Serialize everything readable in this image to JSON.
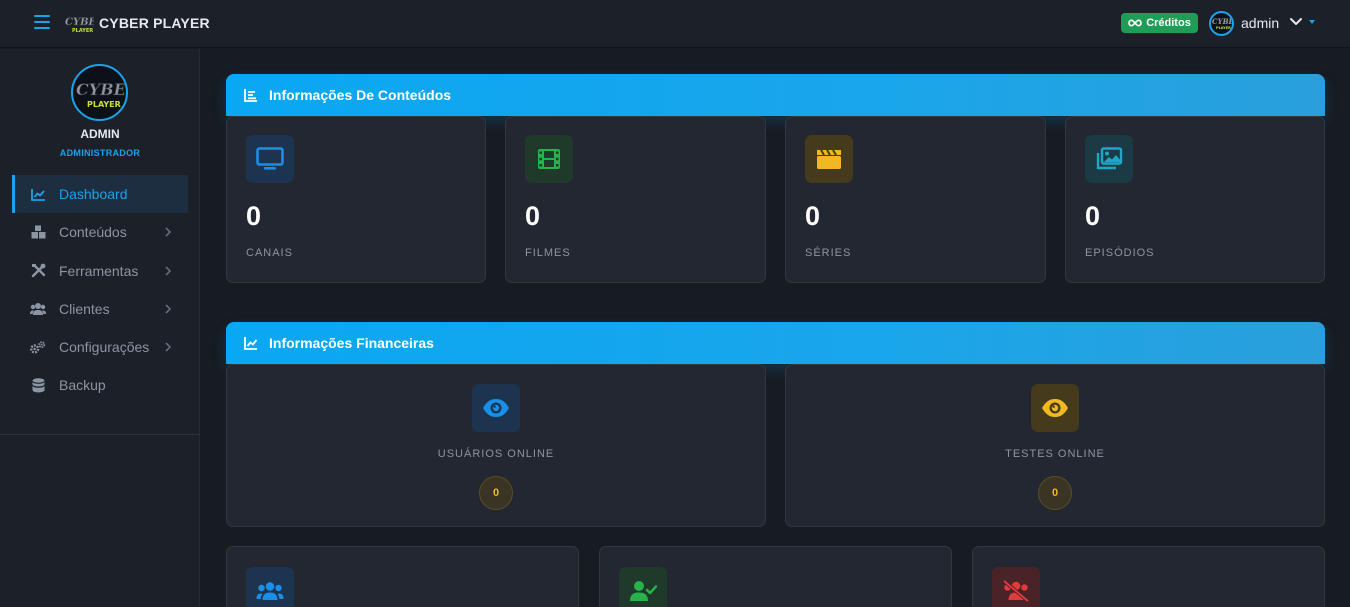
{
  "header": {
    "brand_logo_text": "CYBER PLAYER",
    "brand_title": "CYBER PLAYER",
    "credits_label": "Créditos",
    "user_name": "admin"
  },
  "sidebar": {
    "avatar_logo_text": "CYBER PLAYER",
    "user_name": "ADMIN",
    "user_role": "ADMINISTRADOR",
    "items": [
      {
        "label": "Dashboard",
        "icon": "chart-line-icon",
        "active": true,
        "has_submenu": false
      },
      {
        "label": "Conteúdos",
        "icon": "boxes-icon",
        "active": false,
        "has_submenu": true
      },
      {
        "label": "Ferramentas",
        "icon": "tools-icon",
        "active": false,
        "has_submenu": true
      },
      {
        "label": "Clientes",
        "icon": "users-icon",
        "active": false,
        "has_submenu": true
      },
      {
        "label": "Configurações",
        "icon": "cogs-icon",
        "active": false,
        "has_submenu": true
      },
      {
        "label": "Backup",
        "icon": "database-icon",
        "active": false,
        "has_submenu": false
      }
    ]
  },
  "content_section": {
    "title": "Informações De Conteúdos",
    "cards": [
      {
        "value": "0",
        "label": "CANAIS",
        "icon": "tv-icon",
        "color": "#1a8fe8"
      },
      {
        "value": "0",
        "label": "FILMES",
        "icon": "film-icon",
        "color": "#27b24a"
      },
      {
        "value": "0",
        "label": "SÉRIES",
        "icon": "clapperboard-icon",
        "color": "#f2b824"
      },
      {
        "value": "0",
        "label": "EPISÓDIOS",
        "icon": "images-icon",
        "color": "#1aa7c8"
      }
    ]
  },
  "finance_section": {
    "title": "Informações Financeiras",
    "cards": [
      {
        "label": "USUÁRIOS ONLINE",
        "value": "0",
        "icon": "eye-icon",
        "color": "#1a8fe8"
      },
      {
        "label": "TESTES ONLINE",
        "value": "0",
        "icon": "eye-icon",
        "color": "#f2b824"
      }
    ]
  },
  "bottom_cards": [
    {
      "icon": "users-icon",
      "color": "#1a8fe8"
    },
    {
      "icon": "user-check-icon",
      "color": "#27b24a"
    },
    {
      "icon": "users-slash-icon",
      "color": "#e23b3b"
    }
  ],
  "colors": {
    "accent": "#1aa3e8",
    "credits": "#1f9d57",
    "background": "#171b22",
    "card": "#232731"
  }
}
